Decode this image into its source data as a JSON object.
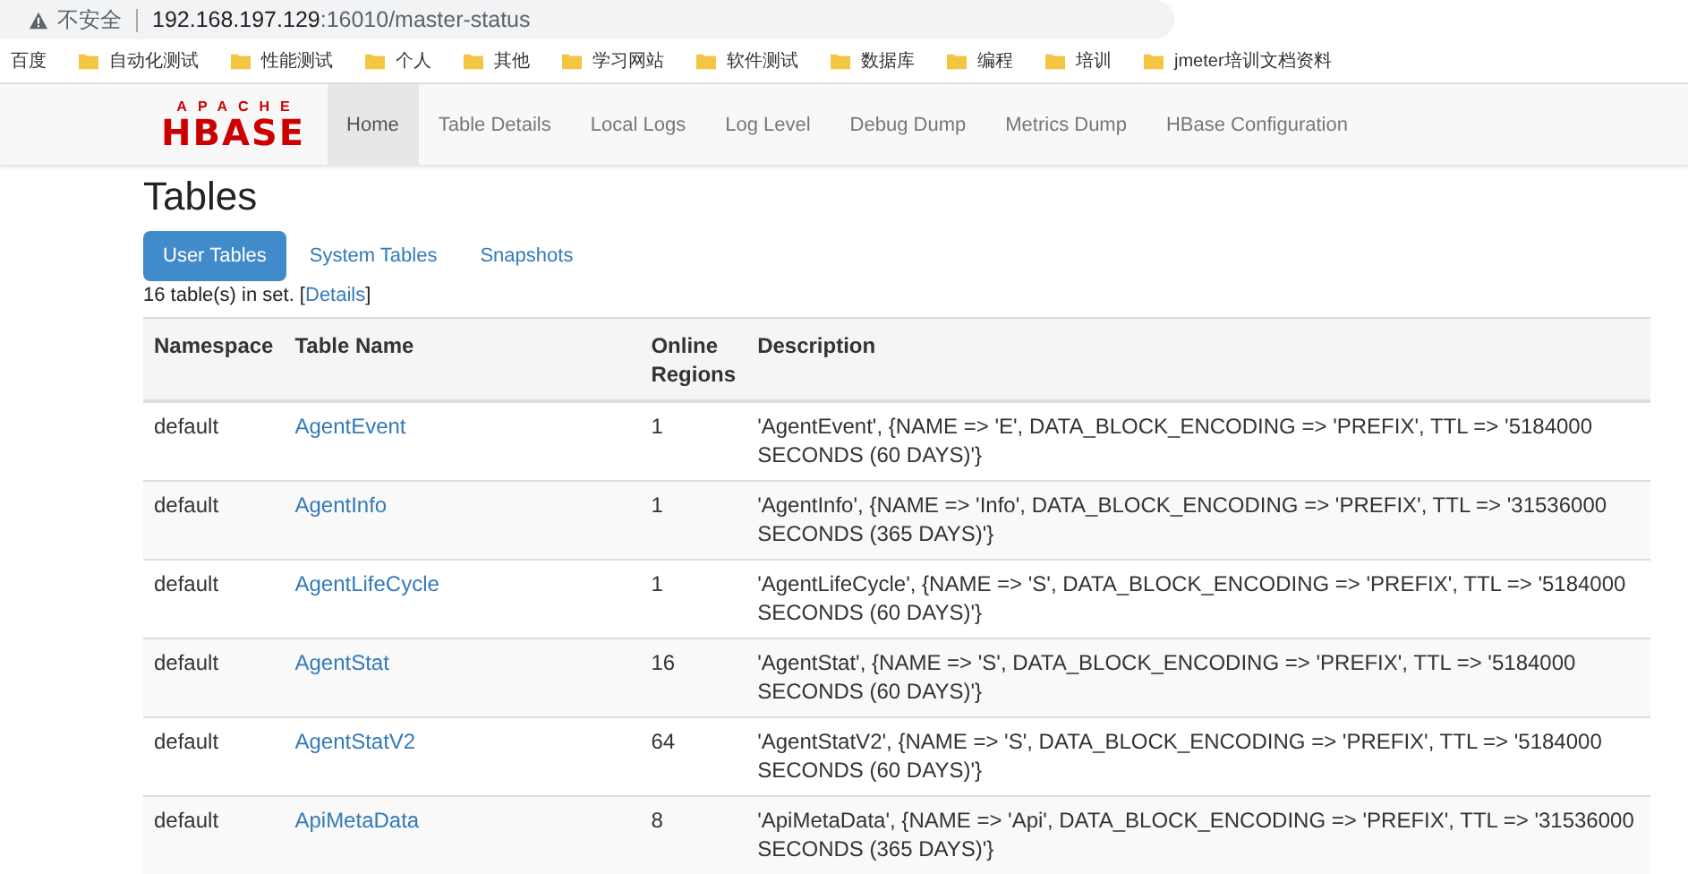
{
  "browser": {
    "security_label": "不安全",
    "url_host": "192.168.197.129",
    "url_rest": ":16010/master-status",
    "bookmarks": [
      {
        "label": "百度",
        "kind": "plain"
      },
      {
        "label": "自动化测试",
        "kind": "folder"
      },
      {
        "label": "性能测试",
        "kind": "folder"
      },
      {
        "label": "个人",
        "kind": "folder"
      },
      {
        "label": "其他",
        "kind": "folder"
      },
      {
        "label": "学习网站",
        "kind": "folder"
      },
      {
        "label": "软件测试",
        "kind": "folder"
      },
      {
        "label": "数据库",
        "kind": "folder"
      },
      {
        "label": "编程",
        "kind": "folder"
      },
      {
        "label": "培训",
        "kind": "folder"
      },
      {
        "label": "jmeter培训文档资料",
        "kind": "folder"
      }
    ]
  },
  "navbar": {
    "logo_top": "APACHE",
    "logo_main": "HBASE",
    "items": [
      {
        "label": "Home",
        "selected": true
      },
      {
        "label": "Table Details",
        "selected": false
      },
      {
        "label": "Local Logs",
        "selected": false
      },
      {
        "label": "Log Level",
        "selected": false
      },
      {
        "label": "Debug Dump",
        "selected": false
      },
      {
        "label": "Metrics Dump",
        "selected": false
      },
      {
        "label": "HBase Configuration",
        "selected": false
      }
    ]
  },
  "heading": "Tables",
  "tabs": [
    {
      "label": "User Tables",
      "selected": true
    },
    {
      "label": "System Tables",
      "selected": false
    },
    {
      "label": "Snapshots",
      "selected": false
    }
  ],
  "summary": {
    "text": "16 table(s) in set. [",
    "link": "Details",
    "after": "]"
  },
  "table": {
    "columns": [
      "Namespace",
      "Table Name",
      "Online Regions",
      "Description"
    ],
    "rows": [
      {
        "namespace": "default",
        "name": "AgentEvent",
        "regions": "1",
        "description": "'AgentEvent', {NAME => 'E', DATA_BLOCK_ENCODING => 'PREFIX', TTL => '5184000 SECONDS (60 DAYS)'}"
      },
      {
        "namespace": "default",
        "name": "AgentInfo",
        "regions": "1",
        "description": "'AgentInfo', {NAME => 'Info', DATA_BLOCK_ENCODING => 'PREFIX', TTL => '31536000 SECONDS (365 DAYS)'}"
      },
      {
        "namespace": "default",
        "name": "AgentLifeCycle",
        "regions": "1",
        "description": "'AgentLifeCycle', {NAME => 'S', DATA_BLOCK_ENCODING => 'PREFIX', TTL => '5184000 SECONDS (60 DAYS)'}"
      },
      {
        "namespace": "default",
        "name": "AgentStat",
        "regions": "16",
        "description": "'AgentStat', {NAME => 'S', DATA_BLOCK_ENCODING => 'PREFIX', TTL => '5184000 SECONDS (60 DAYS)'}"
      },
      {
        "namespace": "default",
        "name": "AgentStatV2",
        "regions": "64",
        "description": "'AgentStatV2', {NAME => 'S', DATA_BLOCK_ENCODING => 'PREFIX', TTL => '5184000 SECONDS (60 DAYS)'}"
      },
      {
        "namespace": "default",
        "name": "ApiMetaData",
        "regions": "8",
        "description": "'ApiMetaData', {NAME => 'Api', DATA_BLOCK_ENCODING => 'PREFIX', TTL => '31536000 SECONDS (365 DAYS)'}"
      }
    ]
  }
}
